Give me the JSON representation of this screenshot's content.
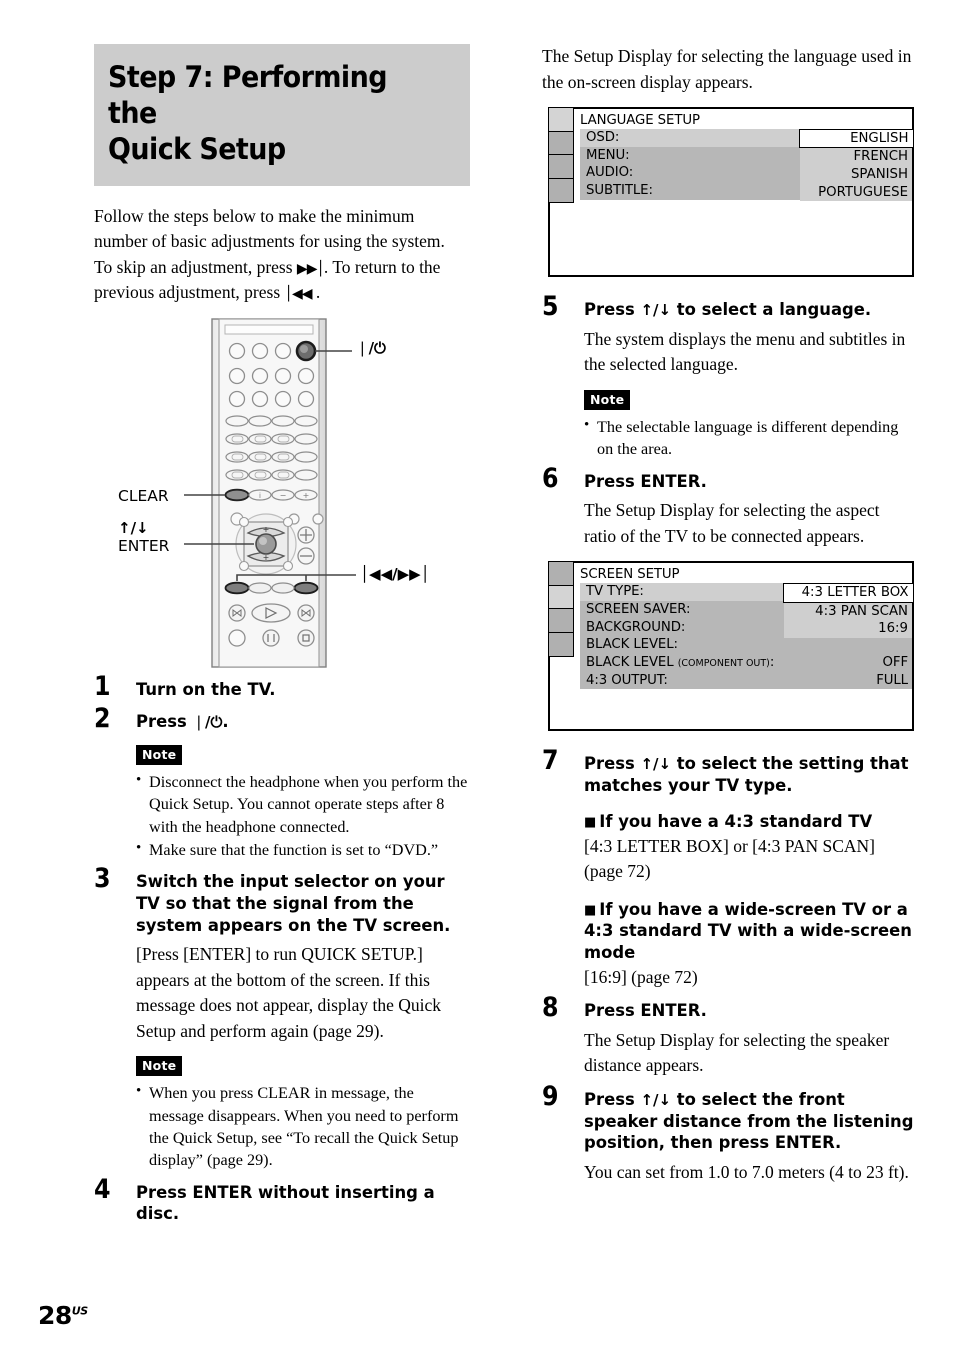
{
  "heading": {
    "line1": "Step 7: Performing the",
    "line2": "Quick Setup"
  },
  "intro": {
    "p1": "Follow the steps below to make the minimum number of basic adjustments for using the system.",
    "p2_a": "To skip an adjustment, press ",
    "p2_sym1": "▶▶│",
    "p2_b": ". To return to the previous adjustment, press ",
    "p2_sym2": "│◀◀",
    "p2_c": " ."
  },
  "remote": {
    "label_power": "❘/⏻",
    "label_clear": "CLEAR",
    "label_updown": "↑/↓",
    "label_enter": "ENTER",
    "label_skip": "│◀◀/▶▶│"
  },
  "steps": [
    {
      "num": "1",
      "title": "Turn on the TV."
    },
    {
      "num": "2",
      "title_a": "Press ",
      "title_sym": "❘/⏻",
      "title_b": ".",
      "note_label": "Note",
      "notes": [
        "Disconnect the headphone when you perform the Quick Setup. You cannot operate steps after 8 with the headphone connected.",
        "Make sure that the function is set to “DVD.”"
      ]
    },
    {
      "num": "3",
      "title": "Switch the input selector on your TV so that the signal from the system appears on the TV screen.",
      "desc": "[Press [ENTER] to run QUICK SETUP.] appears at the bottom of the screen. If this message does not appear, display the Quick Setup and perform again (page 29).",
      "note_label": "Note",
      "notes": [
        "When you press CLEAR in message, the message disappears. When you need to perform the Quick Setup, see “To recall the Quick Setup display” (page 29)."
      ]
    },
    {
      "num": "4",
      "title": "Press ENTER without inserting a disc."
    },
    {
      "num": "5",
      "title_a": "Press ",
      "title_sym": "↑/↓",
      "title_b": " to select a language.",
      "desc": "The system displays the menu and subtitles in the selected language.",
      "note_label": "Note",
      "notes": [
        "The selectable language is different depending on the area."
      ]
    },
    {
      "num": "6",
      "title": "Press ENTER.",
      "desc": "The Setup Display for selecting the aspect ratio of the TV to be connected appears."
    },
    {
      "num": "7",
      "title_a": "Press ",
      "title_sym": "↑/↓",
      "title_b": " to select the setting that matches your TV type.",
      "sub1": "If you have a 4:3 standard TV",
      "sub1_desc": "[4:3 LETTER BOX] or [4:3 PAN SCAN] (page 72)",
      "sub2": "If you have a wide-screen TV or a 4:3 standard TV with a wide-screen mode",
      "sub2_desc": "[16:9] (page 72)"
    },
    {
      "num": "8",
      "title": "Press ENTER.",
      "desc": "The Setup Display for selecting the speaker distance appears."
    },
    {
      "num": "9",
      "title_a": "Press ",
      "title_sym": "↑/↓",
      "title_b": " to select the front speaker distance from the listening position, then press ENTER.",
      "desc": "You can set from 1.0 to 7.0 meters (4 to 23 ft)."
    }
  ],
  "right_intro": "The Setup Display for selecting the language used in the on-screen display appears.",
  "osd_language": {
    "title": "LANGUAGE SETUP",
    "active_tab_index": 0,
    "tab_count": 4,
    "rows": [
      {
        "label": "OSD:",
        "value": "ENGLISH",
        "lite": true
      },
      {
        "label": "MENU:",
        "value": "",
        "lite": false
      },
      {
        "label": "AUDIO:",
        "value": "",
        "lite": false
      },
      {
        "label": "SUBTITLE:",
        "value": "",
        "lite": false
      }
    ],
    "dropdown": {
      "options": [
        "ENGLISH",
        "FRENCH",
        "SPANISH",
        "PORTUGUESE"
      ],
      "selected_index": 0
    }
  },
  "osd_screen": {
    "title": "SCREEN SETUP",
    "active_tab_index": 1,
    "tab_count": 4,
    "rows": [
      {
        "label": "TV TYPE:",
        "value": "4:3 LETTER BOX",
        "lite": true
      },
      {
        "label": "SCREEN SAVER:",
        "value": "",
        "lite": false
      },
      {
        "label": "BACKGROUND:",
        "value": "",
        "lite": false
      },
      {
        "label": "BLACK LEVEL:",
        "value": "",
        "lite": false
      },
      {
        "label": "BLACK LEVEL",
        "label_small": "(COMPONENT OUT)",
        "label_tail": ":",
        "value": "OFF",
        "lite": false
      },
      {
        "label": "4:3 OUTPUT:",
        "value": "FULL",
        "lite": false
      }
    ],
    "dropdown": {
      "options": [
        "4:3 LETTER BOX",
        "4:3 PAN SCAN",
        "16:9"
      ],
      "selected_index": 0
    }
  },
  "footer": {
    "page_number": "28",
    "page_suffix": "US"
  }
}
